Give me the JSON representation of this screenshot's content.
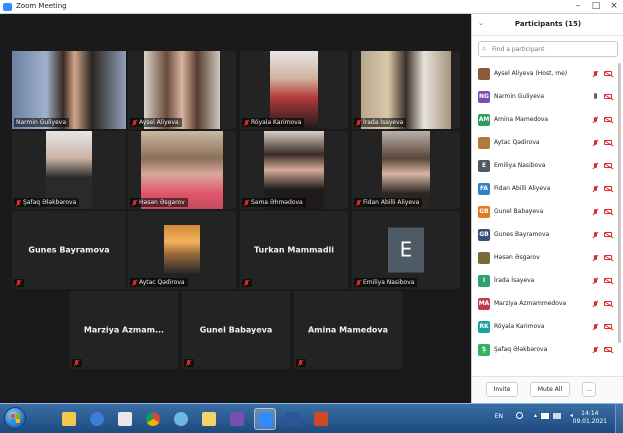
{
  "window": {
    "title": "Zoom Meeting"
  },
  "gallery": {
    "tiles": [
      {
        "name": "Narmin Guliyeva",
        "label_muted": false
      },
      {
        "name": "Aysel Aliyeva",
        "label_muted": true
      },
      {
        "name": "Röyala Karimova",
        "label_muted": true
      },
      {
        "name": "İrada İsayeva",
        "label_muted": true
      },
      {
        "name": "Şafaq Ələkbərova",
        "label_muted": true
      },
      {
        "name": "Həsən Əsgərov",
        "label_muted": true
      },
      {
        "name": "Səma Əhmədova",
        "label_muted": true
      },
      {
        "name": "Fidan Abilli Aliyeva",
        "label_muted": true
      },
      {
        "name": "Gunes Bayramova",
        "label_muted": true
      },
      {
        "name": "Aytac Qədirova",
        "label_muted": true
      },
      {
        "name": "Turkan Mammadli",
        "label_muted": true
      },
      {
        "name": "Emiliya Nasibova",
        "label_muted": true,
        "avatar_letter": "E"
      },
      {
        "name": "Marziya Azmam...",
        "label_muted": true
      },
      {
        "name": "Gunel Babayeva",
        "label_muted": true
      },
      {
        "name": "Amina Mamedova",
        "label_muted": true
      }
    ]
  },
  "participants": {
    "title": "Participants (15)",
    "search_placeholder": "Find a participant",
    "rows": [
      {
        "name": "Aysel Aliyeva (Host, me)",
        "initials": "",
        "color": "#8a5a3c",
        "mic": "muted"
      },
      {
        "name": "Narmin Guliyeva",
        "initials": "NG",
        "color": "#7d4bb3",
        "mic": "on"
      },
      {
        "name": "Amina Mamedova",
        "initials": "AM",
        "color": "#2e9e5b",
        "mic": "muted"
      },
      {
        "name": "Aytac Qədirova",
        "initials": "",
        "color": "#b07a3a",
        "mic": "muted"
      },
      {
        "name": "Emiliya Nasibova",
        "initials": "E",
        "color": "#4e5a66",
        "mic": "muted"
      },
      {
        "name": "Fidan Abilli Aliyeva",
        "initials": "FA",
        "color": "#2f80c8",
        "mic": "muted"
      },
      {
        "name": "Gunel Babayeva",
        "initials": "GB",
        "color": "#e07a1f",
        "mic": "muted"
      },
      {
        "name": "Gunes Bayramova",
        "initials": "GB",
        "color": "#3a4e7a",
        "mic": "muted"
      },
      {
        "name": "Həsən Əsgərov",
        "initials": "",
        "color": "#7a6a3a",
        "mic": "muted"
      },
      {
        "name": "İrada İsayeva",
        "initials": "I",
        "color": "#2ca36b",
        "mic": "muted"
      },
      {
        "name": "Marziya Azmammedova",
        "initials": "MA",
        "color": "#c23b4a",
        "mic": "muted"
      },
      {
        "name": "Röyala Karimova",
        "initials": "RK",
        "color": "#18a39a",
        "mic": "muted"
      },
      {
        "name": "Şafaq Ələkbərova",
        "initials": "Ş",
        "color": "#2fb35c",
        "mic": "muted"
      }
    ],
    "invite_label": "Invite",
    "mute_all_label": "Mute All",
    "more_label": "..."
  },
  "taskbar": {
    "language": "EN",
    "time": "14:14",
    "date": "09.01.2021"
  },
  "colors": {
    "active_speaker_border": "#f5e33a",
    "muted_red": "#e02828",
    "zoom_blue": "#2d8cff"
  }
}
